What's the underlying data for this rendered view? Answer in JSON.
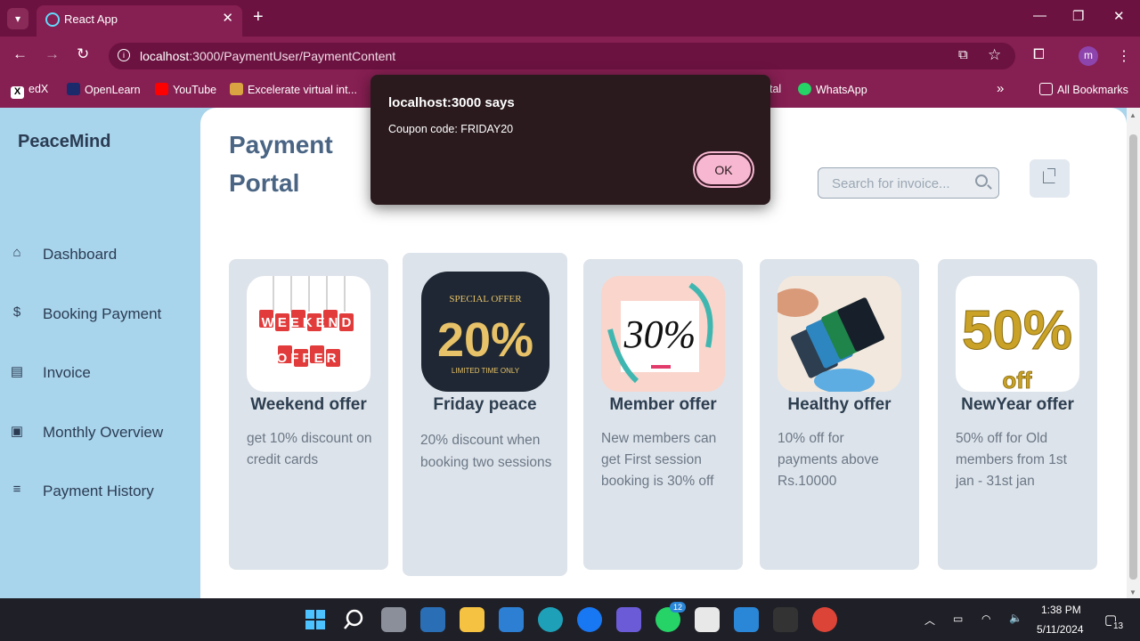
{
  "browser": {
    "tab_title": "React App",
    "url_host": "localhost",
    "url_path": ":3000/PaymentUser/PaymentContent",
    "profile_initial": "m",
    "bookmarks": [
      "edX",
      "OpenLearn",
      "YouTube",
      "Excelerate virtual int...",
      "tal",
      "WhatsApp"
    ],
    "all_bookmarks": "All Bookmarks",
    "overflow": "»"
  },
  "sidebar": {
    "brand": "PeaceMind",
    "items": [
      {
        "label": "Dashboard",
        "icon": "home-icon"
      },
      {
        "label": "Booking Payment",
        "icon": "dollar-icon"
      },
      {
        "label": "Invoice",
        "icon": "invoice-icon"
      },
      {
        "label": "Monthly Overview",
        "icon": "chart-icon"
      },
      {
        "label": "Payment History",
        "icon": "history-icon"
      }
    ]
  },
  "main": {
    "title": "Payment Portal",
    "search_placeholder": "Search for invoice...",
    "cards": [
      {
        "title": "Weekend offer",
        "desc": "get 10% discount on credit cards",
        "img_text": "WEEKEND OFFER"
      },
      {
        "title": "Friday peace",
        "desc": "20% discount when booking two sessions",
        "img_text": "20%",
        "img_top": "SPECIAL OFFER",
        "img_bottom": "LIMITED TIME ONLY"
      },
      {
        "title": "Member offer",
        "desc": "New members can get First session booking is 30% off",
        "img_text": "30%"
      },
      {
        "title": "Healthy offer",
        "desc": "10% off for payments above Rs.10000"
      },
      {
        "title": "NewYear offer",
        "desc": "50% off for Old members from 1st jan - 31st jan",
        "img_text": "50%",
        "img_bottom": "off"
      }
    ]
  },
  "dialog": {
    "heading": "localhost:3000 says",
    "message": "Coupon code: FRIDAY20",
    "ok_label": "OK"
  },
  "taskbar": {
    "time": "1:38 PM",
    "date": "5/11/2024",
    "whatsapp_badge": "12",
    "notif_count": "13"
  },
  "colors": {
    "browser_frame": "#861f52",
    "sidebar_bg": "#a8d4ec",
    "card_bg": "#dde3ea",
    "dialog_bg": "#2a1a1e",
    "ok_button": "#f7b7d0"
  }
}
